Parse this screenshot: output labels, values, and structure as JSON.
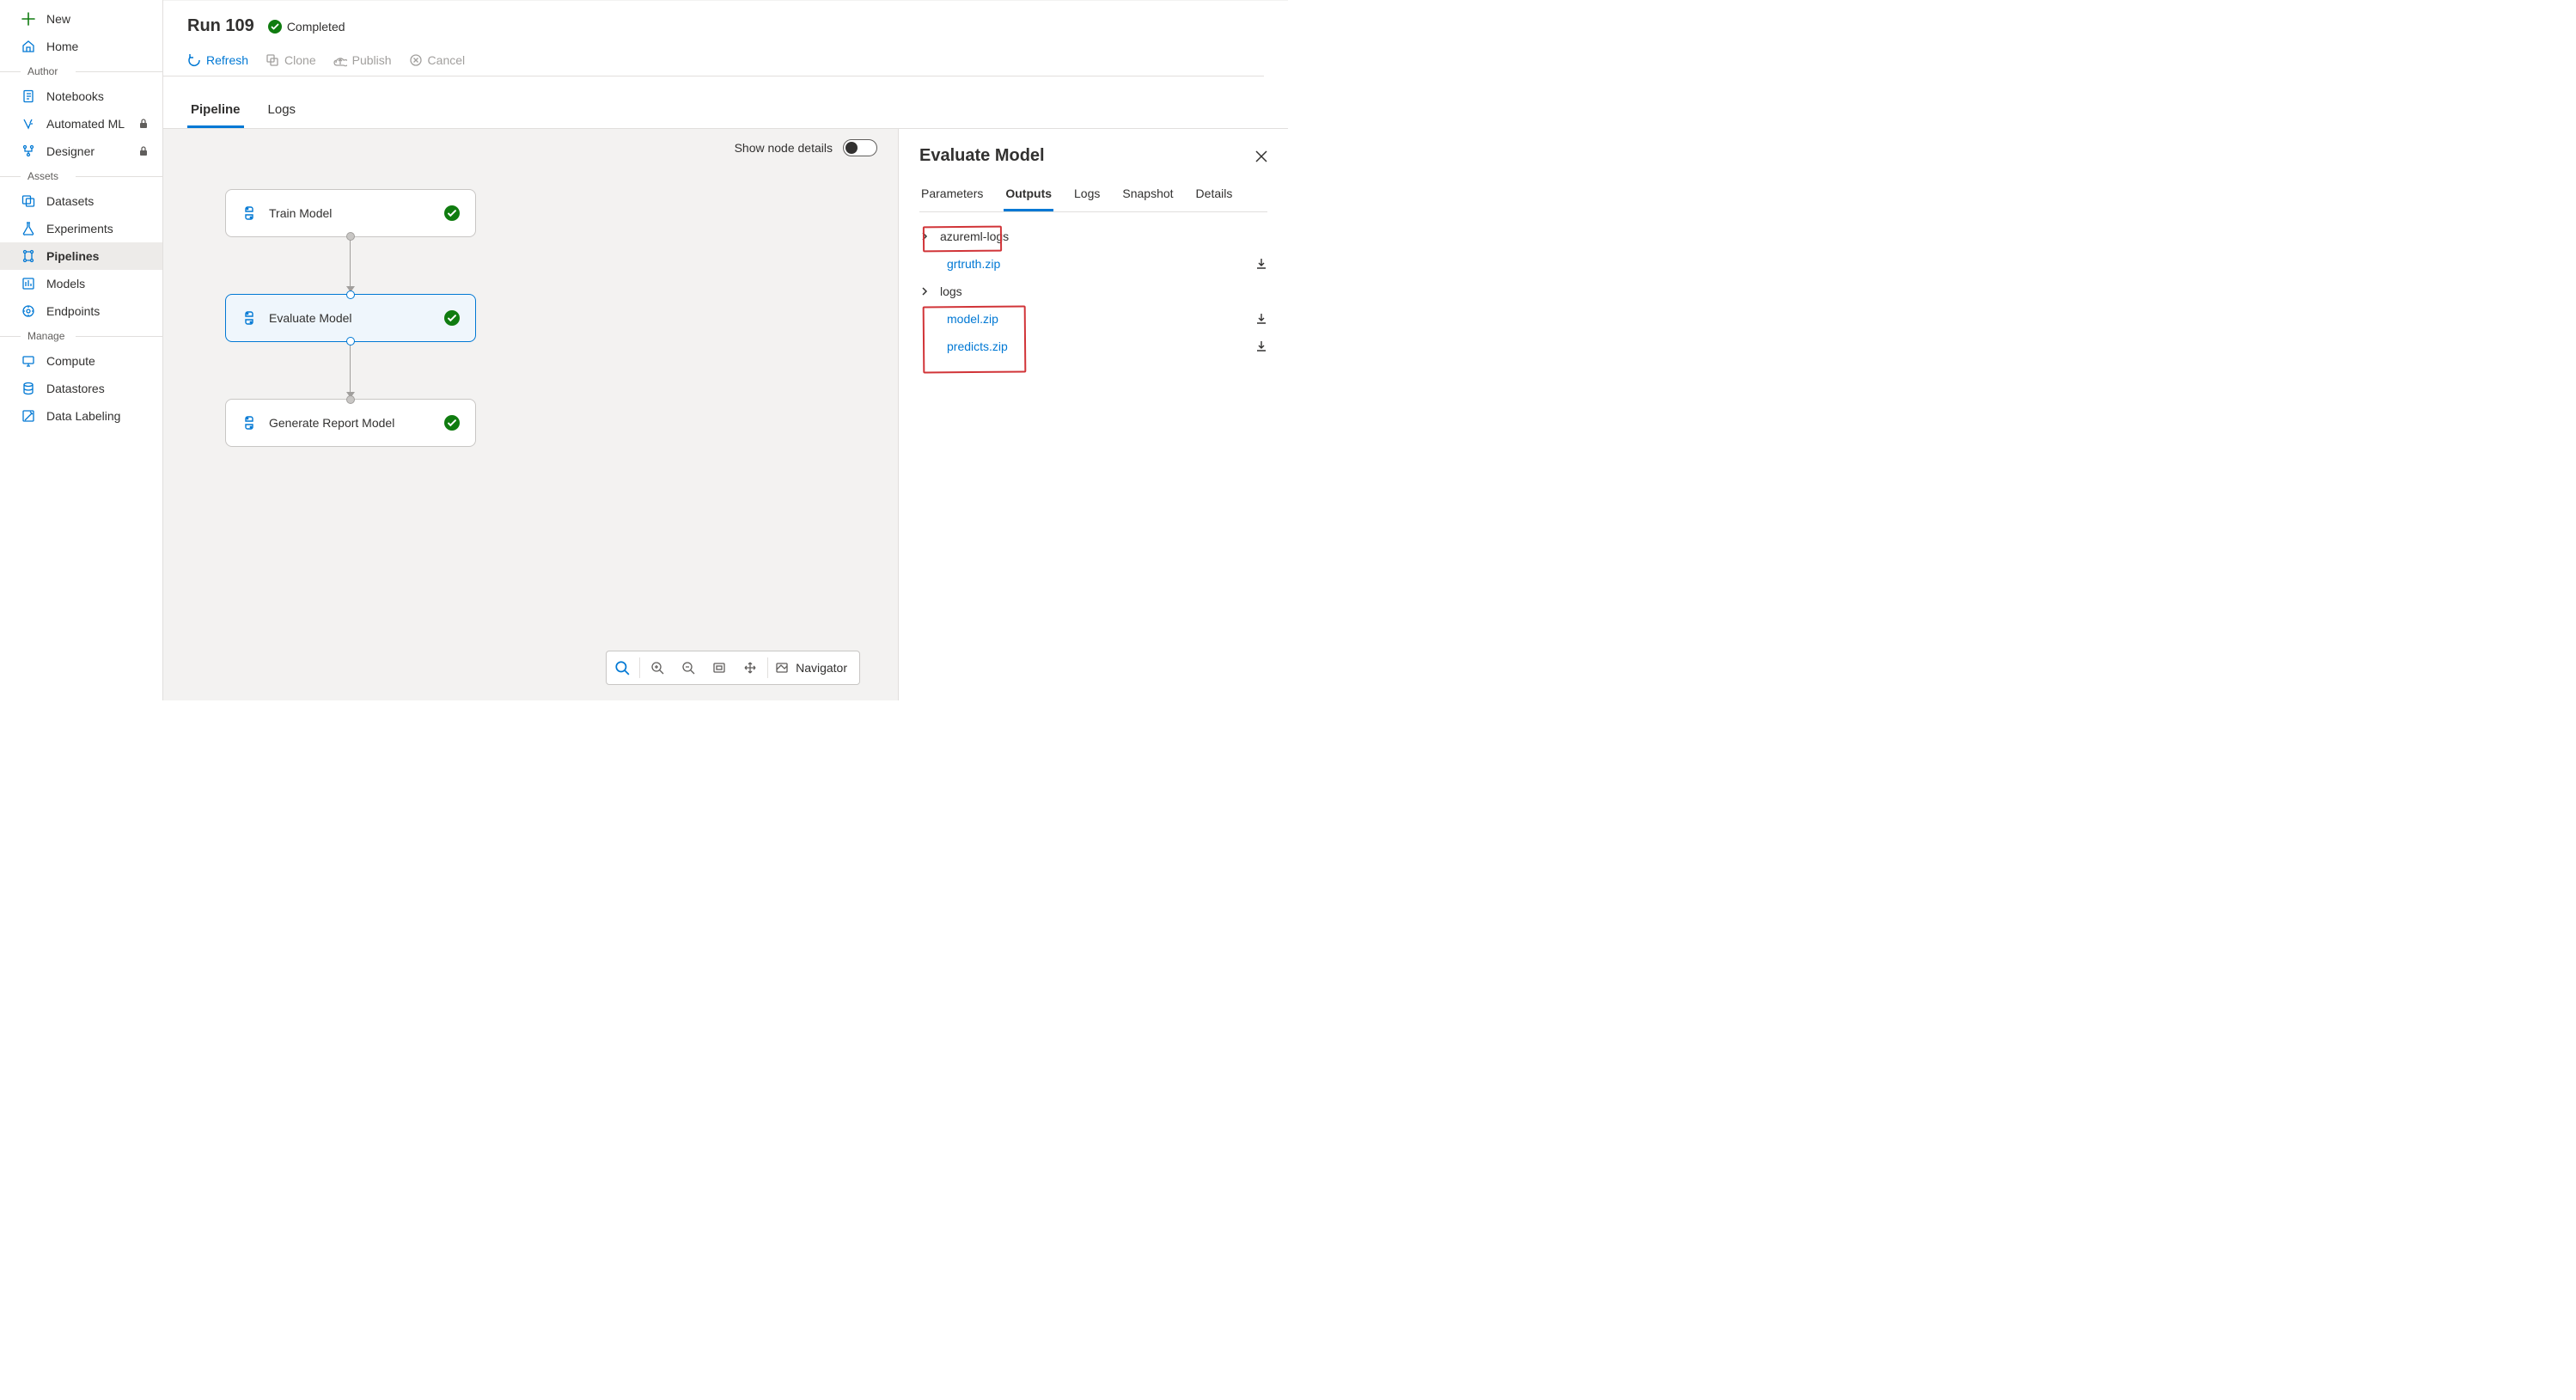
{
  "sidebar": {
    "new": "New",
    "home": "Home",
    "author_label": "Author",
    "notebooks": "Notebooks",
    "automated_ml": "Automated ML",
    "designer": "Designer",
    "assets_label": "Assets",
    "datasets": "Datasets",
    "experiments": "Experiments",
    "pipelines": "Pipelines",
    "models": "Models",
    "endpoints": "Endpoints",
    "manage_label": "Manage",
    "compute": "Compute",
    "datastores": "Datastores",
    "data_labeling": "Data Labeling"
  },
  "header": {
    "title": "Run 109",
    "status_label": "Completed"
  },
  "actions": {
    "refresh": "Refresh",
    "clone": "Clone",
    "publish": "Publish",
    "cancel": "Cancel"
  },
  "content_tabs": {
    "pipeline": "Pipeline",
    "logs": "Logs"
  },
  "canvas": {
    "show_node_details": "Show node details",
    "nodes": {
      "train": "Train Model",
      "evaluate": "Evaluate Model",
      "report": "Generate Report Model"
    },
    "navigator": "Navigator"
  },
  "panel": {
    "title": "Evaluate Model",
    "tabs": {
      "parameters": "Parameters",
      "outputs": "Outputs",
      "logs": "Logs",
      "snapshot": "Snapshot",
      "details": "Details"
    },
    "tree": {
      "folder1": "azureml-logs",
      "file1": "grtruth.zip",
      "folder2": "logs",
      "file2": "model.zip",
      "file3": "predicts.zip"
    }
  }
}
